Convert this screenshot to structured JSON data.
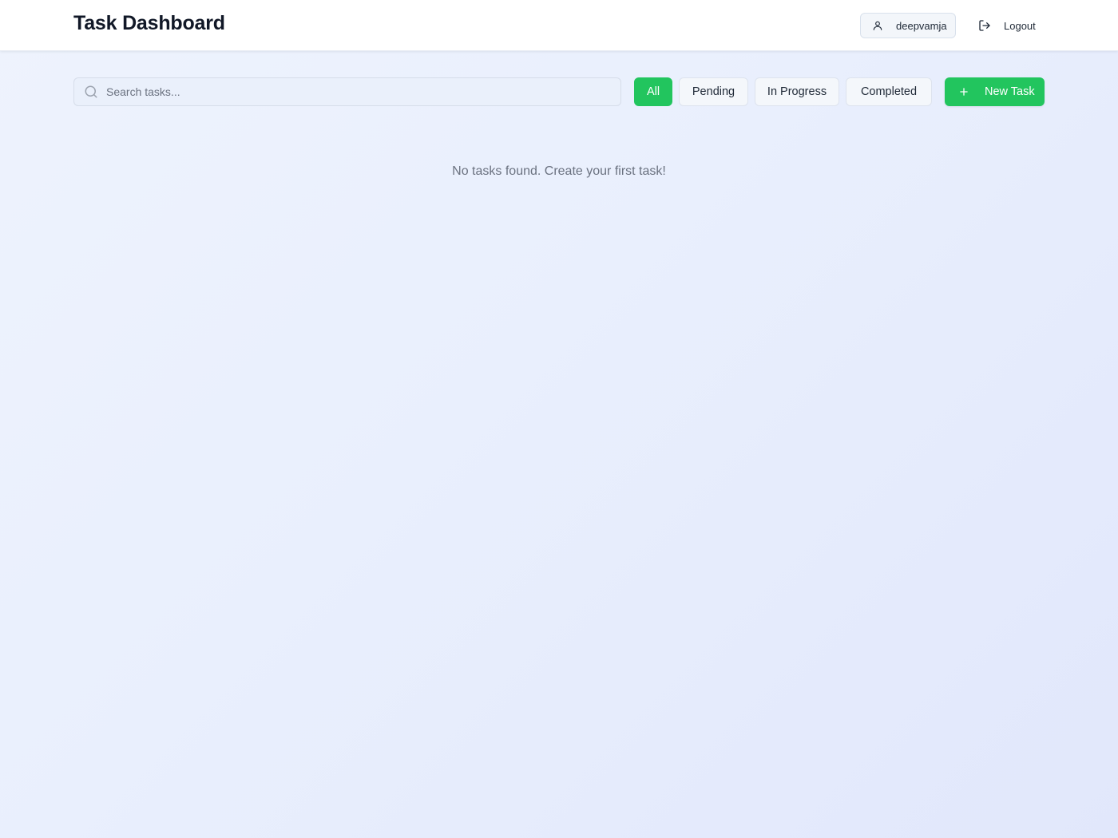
{
  "header": {
    "title": "Task Dashboard",
    "user": {
      "icon": "user-icon",
      "username": "deepvamja"
    },
    "logout": {
      "icon": "logout-icon",
      "label": "Logout"
    }
  },
  "toolbar": {
    "search": {
      "icon": "search-icon",
      "placeholder": "Search tasks...",
      "value": ""
    },
    "filters": [
      {
        "label": "All",
        "active": true
      },
      {
        "label": "Pending",
        "active": false
      },
      {
        "label": "In Progress",
        "active": false
      },
      {
        "label": "Completed",
        "active": false
      }
    ],
    "new_task": {
      "icon": "plus-icon",
      "label": "New Task"
    }
  },
  "main": {
    "empty_message": "No tasks found. Create your first task!"
  },
  "colors": {
    "accent": "#22c55e",
    "text_primary": "#111827",
    "text_muted": "#6b7280",
    "header_bg": "#ffffff"
  }
}
